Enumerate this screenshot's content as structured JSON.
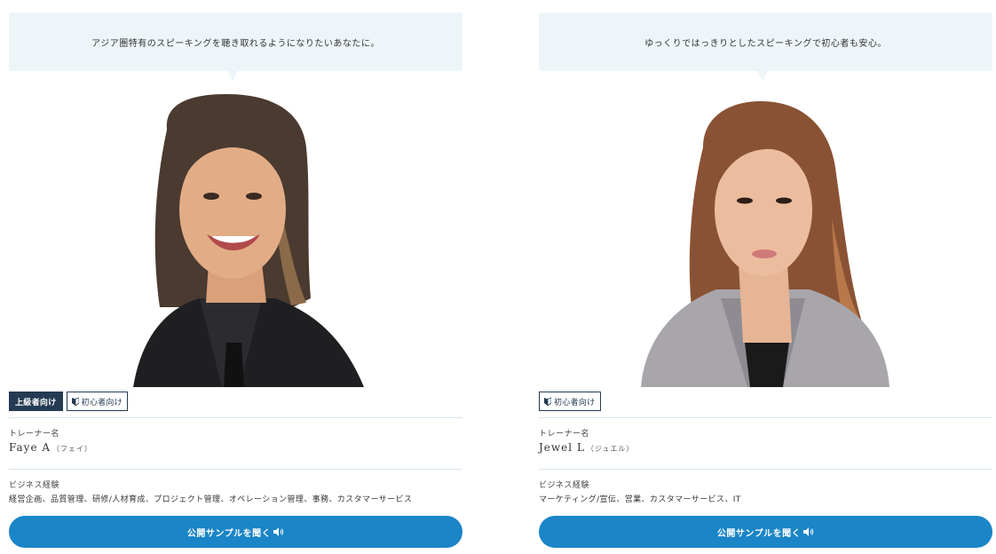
{
  "trainers": [
    {
      "message": "アジア圏特有のスピーキングを聴き取れるようになりたいあなたに。",
      "badges": {
        "advanced": "上級者向け",
        "beginner": "初心者向け"
      },
      "name_label": "トレーナー名",
      "name": "Faye A",
      "name_kana": "（フェイ）",
      "experience_label": "ビジネス経験",
      "experience": "経営企画、品質管理、研修/人材育成、プロジェクト管理、オペレーション管理、事務、カスタマーサービス",
      "sample_button": "公開サンプルを聞く"
    },
    {
      "message": "ゆっくりではっきりとしたスピーキングで初心者も安心。",
      "badges": {
        "beginner": "初心者向け"
      },
      "name_label": "トレーナー名",
      "name": "Jewel L",
      "name_kana": "（ジュエル）",
      "experience_label": "ビジネス経験",
      "experience": "マーケティング/宣伝、営業、カスタマーサービス、IT",
      "sample_button": "公開サンプルを聞く"
    }
  ],
  "colors": {
    "navy": "#243b53",
    "bubble": "#eef5f9",
    "button": "#1a85c7",
    "divider": "#d9e6ef"
  }
}
